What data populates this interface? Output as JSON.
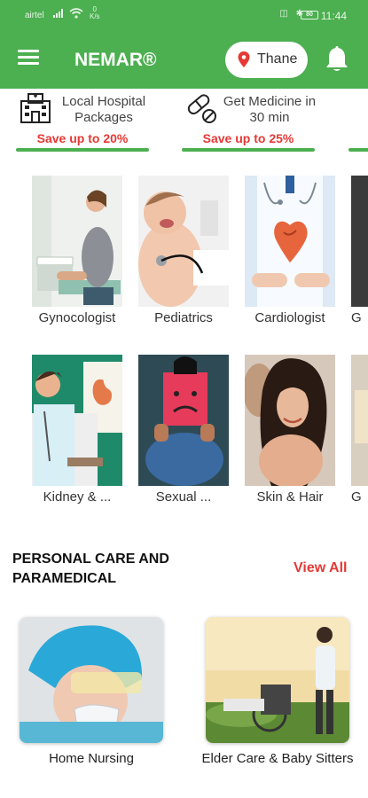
{
  "status_bar": {
    "carrier": "airtel",
    "speed": "0\nK/s",
    "time": "11:44",
    "battery": "80"
  },
  "header": {
    "brand": "NEMAR®",
    "location": "Thane"
  },
  "offers": [
    {
      "title": "Local Hospital Packages",
      "save": "Save up to 20%",
      "icon": "hospital-icon"
    },
    {
      "title": "Get Medicine in 30 min",
      "save": "Save up to 25%",
      "icon": "pills-icon"
    }
  ],
  "categories_row1": [
    {
      "label": "Gynocologist"
    },
    {
      "label": "Pediatrics"
    },
    {
      "label": "Cardiologist"
    },
    {
      "label": "G"
    }
  ],
  "categories_row2": [
    {
      "label": "Kidney & ..."
    },
    {
      "label": "Sexual ..."
    },
    {
      "label": "Skin & Hair"
    },
    {
      "label": "G"
    }
  ],
  "personal_care": {
    "title": "PERSONAL CARE AND PARAMEDICAL",
    "view_all": "View All",
    "items": [
      {
        "label": "Home Nursing"
      },
      {
        "label": "Elder Care & Baby Sitters"
      }
    ]
  },
  "colors": {
    "primary": "#4caf50",
    "accent": "#e53935"
  }
}
